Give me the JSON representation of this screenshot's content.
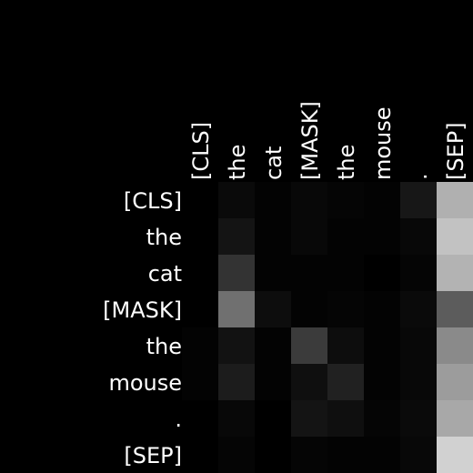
{
  "chart_data": {
    "type": "heatmap",
    "title": "",
    "xlabel": "",
    "ylabel": "",
    "x_labels": [
      "[CLS]",
      "the",
      "cat",
      "[MASK]",
      "the",
      "mouse",
      ".",
      "[SEP]"
    ],
    "y_labels": [
      "[CLS]",
      "the",
      "cat",
      "[MASK]",
      "the",
      "mouse",
      ".",
      "[SEP]"
    ],
    "value_range": [
      0,
      1
    ],
    "colormap": "grayscale",
    "values": [
      [
        0.0,
        0.04,
        0.01,
        0.03,
        0.02,
        0.01,
        0.09,
        0.69
      ],
      [
        0.0,
        0.08,
        0.01,
        0.03,
        0.01,
        0.01,
        0.03,
        0.76
      ],
      [
        0.0,
        0.2,
        0.01,
        0.01,
        0.01,
        0.0,
        0.02,
        0.7
      ],
      [
        0.0,
        0.44,
        0.05,
        0.01,
        0.02,
        0.01,
        0.04,
        0.36
      ],
      [
        0.01,
        0.07,
        0.01,
        0.23,
        0.05,
        0.01,
        0.03,
        0.54
      ],
      [
        0.01,
        0.11,
        0.01,
        0.06,
        0.13,
        0.01,
        0.03,
        0.61
      ],
      [
        0.0,
        0.03,
        0.0,
        0.08,
        0.06,
        0.02,
        0.04,
        0.66
      ],
      [
        0.0,
        0.02,
        0.0,
        0.02,
        0.01,
        0.01,
        0.03,
        0.82
      ]
    ]
  }
}
